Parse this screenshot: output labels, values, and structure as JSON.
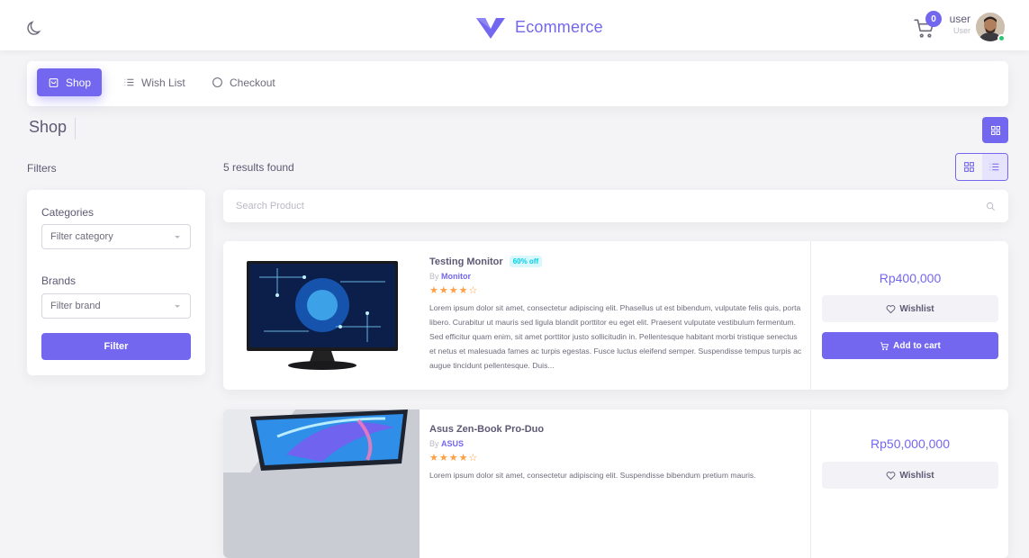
{
  "header": {
    "brand_name": "Ecommerce",
    "cart_count": "0",
    "user_name": "user",
    "user_role": "User"
  },
  "nav": {
    "tabs": [
      {
        "label": "Shop",
        "icon": "bag-icon",
        "active": true
      },
      {
        "label": "Wish List",
        "icon": "list-icon",
        "active": false
      },
      {
        "label": "Checkout",
        "icon": "circle-icon",
        "active": false
      }
    ]
  },
  "page": {
    "title": "Shop",
    "filters_label": "Filters",
    "results_text": "5 results found"
  },
  "filters": {
    "categories_heading": "Categories",
    "category_placeholder": "Filter category",
    "brands_heading": "Brands",
    "brand_placeholder": "Filter brand",
    "filter_button": "Filter"
  },
  "search": {
    "placeholder": "Search Product"
  },
  "products": [
    {
      "name": "Testing Monitor",
      "discount": "60% off",
      "by": "By",
      "brand": "Monitor",
      "stars": "★★★★☆",
      "rating": 4,
      "description": "Lorem ipsum dolor sit amet, consectetur adipiscing elit. Phasellus ut est bibendum, vulputate felis quis, porta libero. Curabitur ut mauris sed ligula blandit porttitor eu eget elit. Praesent vulputate vestibulum fermentum. Sed efficitur quam enim, sit amet porttitor justo sollicitudin in. Pellentesque habitant morbi tristique senectus et netus et malesuada fames ac turpis egestas. Fusce luctus eleifend semper. Suspendisse tempus turpis ac augue tincidunt pellentesque. Duis...",
      "price": "Rp400,000",
      "wishlist_label": "Wishlist",
      "cart_label": "Add to cart"
    },
    {
      "name": "Asus Zen-Book Pro-Duo",
      "by": "By",
      "brand": "ASUS",
      "stars": "★★★★☆",
      "rating": 4,
      "description": "Lorem ipsum dolor sit amet, consectetur adipiscing elit. Suspendisse bibendum pretium mauris.",
      "price": "Rp50,000,000",
      "wishlist_label": "Wishlist"
    }
  ],
  "colors": {
    "primary": "#7367f0",
    "star": "#ff9f43",
    "discount": "#00cfe8",
    "online": "#28c76f"
  }
}
